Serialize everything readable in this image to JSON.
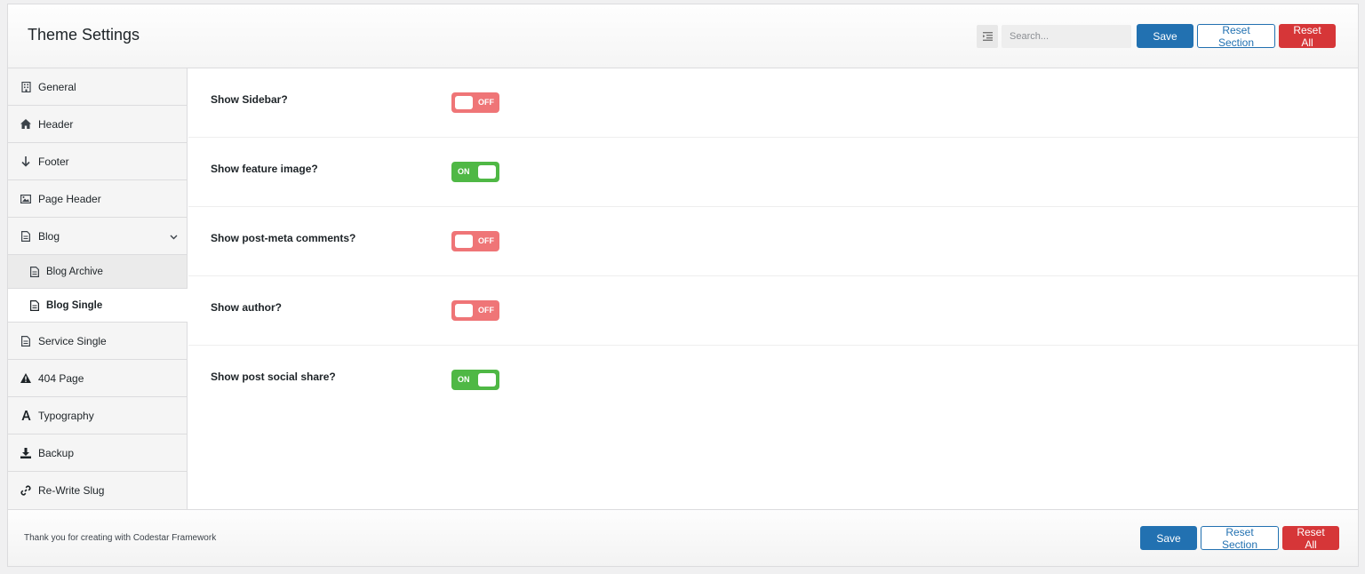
{
  "header": {
    "title": "Theme Settings",
    "search_placeholder": "Search...",
    "save_label": "Save",
    "reset_section_label": "Reset Section",
    "reset_all_label": "Reset All"
  },
  "sidebar": {
    "items": [
      {
        "label": "General",
        "icon": "building-icon"
      },
      {
        "label": "Header",
        "icon": "home-icon"
      },
      {
        "label": "Footer",
        "icon": "arrow-down-icon"
      },
      {
        "label": "Page Header",
        "icon": "image-icon"
      },
      {
        "label": "Blog",
        "icon": "document-icon"
      },
      {
        "label": "Blog Archive",
        "icon": "document-icon"
      },
      {
        "label": "Blog Single",
        "icon": "document-icon"
      },
      {
        "label": "Service Single",
        "icon": "document-icon"
      },
      {
        "label": "404 Page",
        "icon": "warning-icon"
      },
      {
        "label": "Typography",
        "icon": "font-icon"
      },
      {
        "label": "Backup",
        "icon": "download-icon"
      },
      {
        "label": "Re-Write Slug",
        "icon": "link-icon"
      }
    ]
  },
  "fields": [
    {
      "label": "Show Sidebar?",
      "state": "OFF"
    },
    {
      "label": "Show feature image?",
      "state": "ON"
    },
    {
      "label": "Show post-meta comments?",
      "state": "OFF"
    },
    {
      "label": "Show author?",
      "state": "OFF"
    },
    {
      "label": "Show post social share?",
      "state": "ON"
    }
  ],
  "footer": {
    "credit": "Thank you for creating with Codestar Framework",
    "save_label": "Save",
    "reset_section_label": "Reset Section",
    "reset_all_label": "Reset All"
  },
  "colors": {
    "primary": "#2271b1",
    "danger": "#d63638",
    "toggle_on": "#4fb845",
    "toggle_off": "#ef7577"
  }
}
